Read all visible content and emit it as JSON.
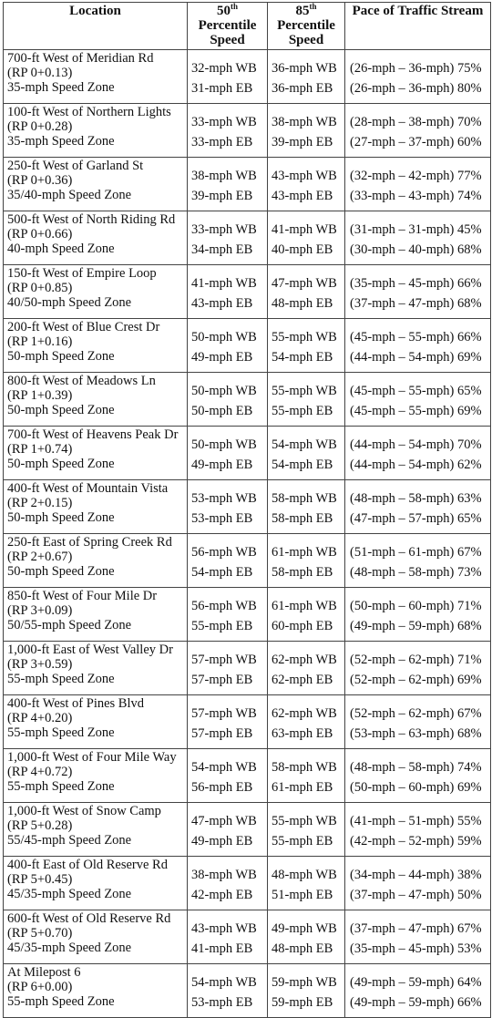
{
  "headers": {
    "location": "Location",
    "p50_num": "50",
    "p50_sup": "th",
    "p50_l1": "Percentile",
    "p50_l2": "Speed",
    "p85_num": "85",
    "p85_sup": "th",
    "p85_l1": "Percentile",
    "p85_l2": "Speed",
    "pace": "Pace of Traffic Stream"
  },
  "rows": [
    {
      "loc": "700-ft West of Meridian Rd",
      "rp": "(RP 0+0.13)",
      "zone": "35-mph Speed Zone",
      "p50wb": "32-mph WB",
      "p50eb": "31-mph EB",
      "p85wb": "36-mph WB",
      "p85eb": "36-mph EB",
      "pacewb": "(26-mph – 36-mph) 75%",
      "paceeb": "(26-mph – 36-mph) 80%"
    },
    {
      "loc": "100-ft West of Northern Lights",
      "rp": "(RP 0+0.28)",
      "zone": "35-mph Speed Zone",
      "p50wb": "33-mph WB",
      "p50eb": "33-mph EB",
      "p85wb": "38-mph WB",
      "p85eb": "39-mph EB",
      "pacewb": "(28-mph – 38-mph) 70%",
      "paceeb": "(27-mph – 37-mph) 60%"
    },
    {
      "loc": "250-ft West of Garland St",
      "rp": "(RP 0+0.36)",
      "zone": "35/40-mph Speed Zone",
      "p50wb": "38-mph WB",
      "p50eb": "39-mph EB",
      "p85wb": "43-mph WB",
      "p85eb": "43-mph EB",
      "pacewb": "(32-mph – 42-mph) 77%",
      "paceeb": "(33-mph – 43-mph) 74%"
    },
    {
      "loc": "500-ft West of North Riding Rd",
      "rp": "(RP 0+0.66)",
      "zone": "40-mph Speed Zone",
      "p50wb": "33-mph WB",
      "p50eb": "34-mph EB",
      "p85wb": "41-mph WB",
      "p85eb": "40-mph EB",
      "pacewb": "(31-mph – 31-mph) 45%",
      "paceeb": "(30-mph – 40-mph) 68%"
    },
    {
      "loc": "150-ft West of Empire Loop",
      "rp": "(RP 0+0.85)",
      "zone": "40/50-mph Speed Zone",
      "p50wb": "41-mph WB",
      "p50eb": "43-mph EB",
      "p85wb": "47-mph WB",
      "p85eb": "48-mph EB",
      "pacewb": "(35-mph – 45-mph) 66%",
      "paceeb": "(37-mph – 47-mph) 68%"
    },
    {
      "loc": "200-ft West of Blue Crest Dr",
      "rp": "(RP 1+0.16)",
      "zone": "50-mph Speed Zone",
      "p50wb": "50-mph WB",
      "p50eb": "49-mph EB",
      "p85wb": "55-mph WB",
      "p85eb": "54-mph EB",
      "pacewb": "(45-mph – 55-mph) 66%",
      "paceeb": "(44-mph – 54-mph) 69%"
    },
    {
      "loc": "800-ft West of Meadows Ln",
      "rp": "(RP 1+0.39)",
      "zone": "50-mph Speed Zone",
      "p50wb": "50-mph WB",
      "p50eb": "50-mph EB",
      "p85wb": "55-mph WB",
      "p85eb": "55-mph EB",
      "pacewb": "(45-mph – 55-mph) 65%",
      "paceeb": "(45-mph – 55-mph) 69%"
    },
    {
      "loc": "700-ft West of Heavens Peak Dr",
      "rp": "(RP 1+0.74)",
      "zone": "50-mph Speed Zone",
      "p50wb": "50-mph WB",
      "p50eb": "49-mph EB",
      "p85wb": "54-mph WB",
      "p85eb": "54-mph EB",
      "pacewb": "(44-mph – 54-mph) 70%",
      "paceeb": "(44-mph – 54-mph) 62%"
    },
    {
      "loc": "400-ft West of Mountain Vista",
      "rp": "(RP 2+0.15)",
      "zone": "50-mph Speed Zone",
      "p50wb": "53-mph WB",
      "p50eb": "53-mph EB",
      "p85wb": "58-mph WB",
      "p85eb": "58-mph EB",
      "pacewb": "(48-mph – 58-mph) 63%",
      "paceeb": "(47-mph – 57-mph) 65%"
    },
    {
      "loc": "250-ft East of Spring Creek Rd",
      "rp": "(RP 2+0.67)",
      "zone": "50-mph Speed Zone",
      "p50wb": "56-mph WB",
      "p50eb": "54-mph EB",
      "p85wb": "61-mph WB",
      "p85eb": "58-mph EB",
      "pacewb": "(51-mph – 61-mph) 67%",
      "paceeb": "(48-mph – 58-mph) 73%"
    },
    {
      "loc": "850-ft West of Four Mile Dr",
      "rp": "(RP 3+0.09)",
      "zone": "50/55-mph Speed Zone",
      "p50wb": "56-mph WB",
      "p50eb": "55-mph EB",
      "p85wb": "61-mph WB",
      "p85eb": "60-mph EB",
      "pacewb": "(50-mph – 60-mph) 71%",
      "paceeb": "(49-mph – 59-mph) 68%"
    },
    {
      "loc": "1,000-ft East of West Valley Dr",
      "rp": "(RP 3+0.59)",
      "zone": "55-mph Speed Zone",
      "p50wb": "57-mph WB",
      "p50eb": "57-mph EB",
      "p85wb": "62-mph WB",
      "p85eb": "62-mph EB",
      "pacewb": "(52-mph – 62-mph) 71%",
      "paceeb": "(52-mph – 62-mph) 69%"
    },
    {
      "loc": "400-ft West of Pines Blvd",
      "rp": "(RP 4+0.20)",
      "zone": "55-mph Speed Zone",
      "p50wb": "57-mph WB",
      "p50eb": "57-mph EB",
      "p85wb": "62-mph WB",
      "p85eb": "63-mph EB",
      "pacewb": "(52-mph – 62-mph) 67%",
      "paceeb": "(53-mph – 63-mph) 68%"
    },
    {
      "loc": "1,000-ft West of Four Mile Way",
      "rp": "(RP 4+0.72)",
      "zone": "55-mph Speed Zone",
      "p50wb": "54-mph WB",
      "p50eb": "56-mph EB",
      "p85wb": "58-mph WB",
      "p85eb": "61-mph EB",
      "pacewb": "(48-mph – 58-mph) 74%",
      "paceeb": "(50-mph – 60-mph) 69%"
    },
    {
      "loc": "1,000-ft West of Snow Camp",
      "rp": "(RP 5+0.28)",
      "zone": "55/45-mph Speed Zone",
      "p50wb": "47-mph WB",
      "p50eb": "49-mph EB",
      "p85wb": "55-mph WB",
      "p85eb": "55-mph EB",
      "pacewb": "(41-mph – 51-mph) 55%",
      "paceeb": "(42-mph – 52-mph) 59%"
    },
    {
      "loc": "400-ft East of Old Reserve Rd",
      "rp": "(RP 5+0.45)",
      "zone": "45/35-mph Speed Zone",
      "p50wb": "38-mph WB",
      "p50eb": "42-mph EB",
      "p85wb": "48-mph WB",
      "p85eb": "51-mph EB",
      "pacewb": "(34-mph – 44-mph) 38%",
      "paceeb": "(37-mph – 47-mph) 50%"
    },
    {
      "loc": "600-ft West of Old Reserve Rd",
      "rp": "(RP 5+0.70)",
      "zone": "45/35-mph Speed Zone",
      "p50wb": "43-mph WB",
      "p50eb": "41-mph EB",
      "p85wb": "49-mph WB",
      "p85eb": "48-mph EB",
      "pacewb": "(37-mph – 47-mph) 67%",
      "paceeb": "(35-mph – 45-mph) 53%"
    },
    {
      "loc": "At Milepost 6",
      "rp": "(RP 6+0.00)",
      "zone": "55-mph Speed Zone",
      "p50wb": "54-mph WB",
      "p50eb": "53-mph EB",
      "p85wb": "59-mph WB",
      "p85eb": "59-mph EB",
      "pacewb": "(49-mph – 59-mph) 64%",
      "paceeb": "(49-mph – 59-mph) 66%"
    }
  ]
}
